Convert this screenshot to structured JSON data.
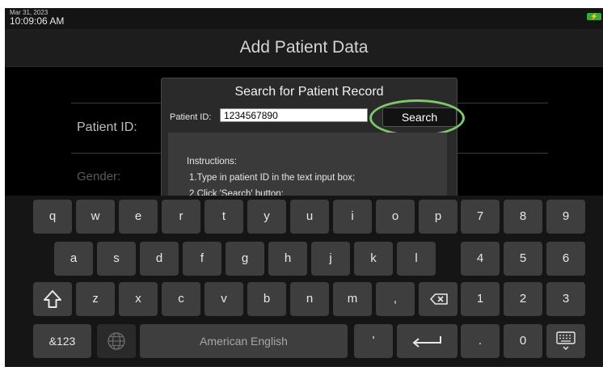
{
  "status": {
    "date": "Mar 31, 2023",
    "time": "10:09:06 AM",
    "battery_icon": "battery-charging-icon"
  },
  "page": {
    "title": "Add Patient Data"
  },
  "background_form": {
    "patient_id_label": "Patient ID:",
    "gender_label": "Gender:"
  },
  "dialog": {
    "title": "Search for Patient Record",
    "patient_id_label": "Patient ID:",
    "patient_id_value": "1234567890",
    "search_button": "Search",
    "highlight_color": "#7cc86a",
    "instructions": [
      "Instructions:",
      "1.Type in patient ID in the text input box;",
      "2.Click 'Search' button:"
    ]
  },
  "keyboard": {
    "row1": [
      "q",
      "w",
      "e",
      "r",
      "t",
      "y",
      "u",
      "i",
      "o",
      "p",
      "7",
      "8",
      "9"
    ],
    "row2": [
      "a",
      "s",
      "d",
      "f",
      "g",
      "h",
      "j",
      "k",
      "l",
      "4",
      "5",
      "6"
    ],
    "row3_letters": [
      "z",
      "x",
      "c",
      "v",
      "b",
      "n",
      "m",
      ","
    ],
    "row3_digits": [
      "1",
      "2",
      "3"
    ],
    "row4": {
      "symbols": "&123",
      "space": "American English",
      "apostrophe": "'",
      "period": ".",
      "zero": "0"
    },
    "icons": {
      "shift": "shift-icon",
      "backspace": "backspace-icon",
      "globe": "globe-icon",
      "enter": "enter-icon",
      "hide": "keyboard-hide-icon"
    }
  }
}
